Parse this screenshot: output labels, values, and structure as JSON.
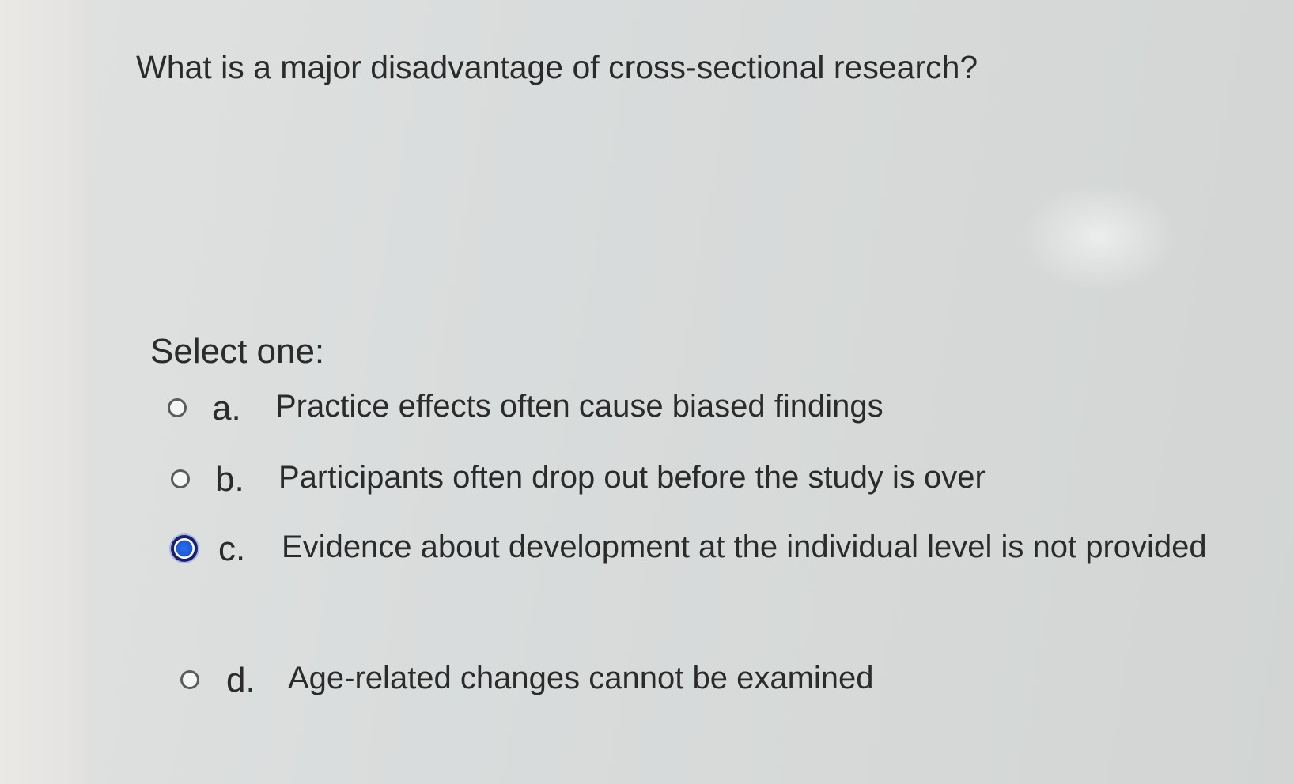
{
  "quiz": {
    "question": "What is a major disadvantage of cross-sectional research?",
    "prompt": "Select one:",
    "options": [
      {
        "letter": "a.",
        "text": "Practice effects often cause biased findings",
        "selected": false
      },
      {
        "letter": "b.",
        "text": "Participants often drop out before the study is over",
        "selected": false
      },
      {
        "letter": "c.",
        "text": "Evidence about development at the individual level is not provided",
        "selected": true
      },
      {
        "letter": "d.",
        "text": "Age-related changes cannot be examined",
        "selected": false
      }
    ]
  },
  "colors": {
    "background": "#d9dcdb",
    "text": "#2b2b2b",
    "radio_selected": "#1d5ad8"
  }
}
